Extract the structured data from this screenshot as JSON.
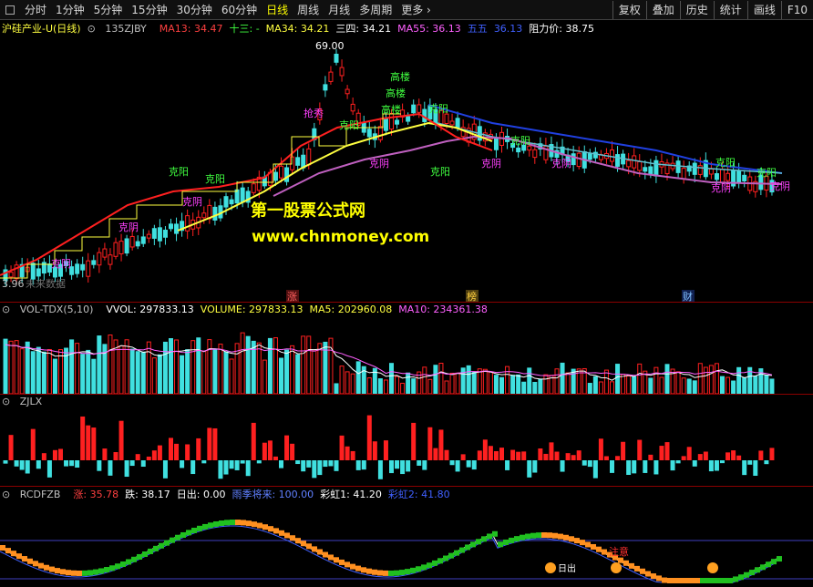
{
  "toolbar": {
    "periods": [
      "分时",
      "1分钟",
      "5分钟",
      "15分钟",
      "30分钟",
      "60分钟",
      "日线",
      "周线",
      "月线",
      "多周期",
      "更多"
    ],
    "active_period": "日线",
    "right_buttons": [
      "复权",
      "叠加",
      "历史",
      "统计",
      "画线",
      "F10"
    ]
  },
  "main_header": {
    "title": "沪硅产业-U(日线)",
    "indicator": "135ZJBY",
    "ma13": "MA13: 34.47",
    "shisan": "十三: -",
    "ma34": "MA34: 34.21",
    "sansi": "三四: 34.21",
    "ma55": "MA55: 36.13",
    "wuwu": "五五",
    "wuwu_val": "36.13",
    "zuli": "阻力价: 38.75"
  },
  "main_labels": {
    "high_price": "69.00",
    "low_price": "3.96",
    "left_marker": "未来数据",
    "kzhang": "涨",
    "kbang": "榜",
    "kcai": "财"
  },
  "annotations": {
    "green": [
      "高楼",
      "高楼",
      "高楼",
      "克阳",
      "克阳",
      "克阳",
      "克阳",
      "克阳",
      "克阳",
      "克阳",
      "克阳"
    ],
    "magenta": [
      "克阴",
      "克阴",
      "克阴",
      "克阴",
      "克阴",
      "克阴",
      "抢秀",
      "克阴",
      "克阴"
    ]
  },
  "watermark": {
    "name": "第一股票公式网",
    "url": "www.chnmoney.com"
  },
  "vol_header": {
    "name": "VOL-TDX(5,10)",
    "vvol": "VVOL: 297833.13",
    "volume": "VOLUME: 297833.13",
    "ma5": "MA5: 202960.08",
    "ma10": "MA10: 234361.38"
  },
  "zjlx_header": {
    "name": "ZJLX"
  },
  "rcd_header": {
    "name": "RCDFZB",
    "zhang": "涨: 35.78",
    "die": "跌: 38.17",
    "richu": "日出: 0.00",
    "yuji": "雨季将来: 100.00",
    "caihong1": "彩虹1: 41.20",
    "caihong2": "彩虹2: 41.80"
  },
  "rcd_labels": {
    "zhuyi": "注意",
    "richu_mark": "日出"
  },
  "colors": {
    "up": "#ff2020",
    "down": "#40e0e0",
    "ma13": "#ff2020",
    "ma34": "#ffff40",
    "ma55": "#c060c0",
    "ma_blue": "#2040e0",
    "ma_cyan": "#60c0d0",
    "annot_green": "#40ff40",
    "annot_magenta": "#ff40ff"
  }
}
